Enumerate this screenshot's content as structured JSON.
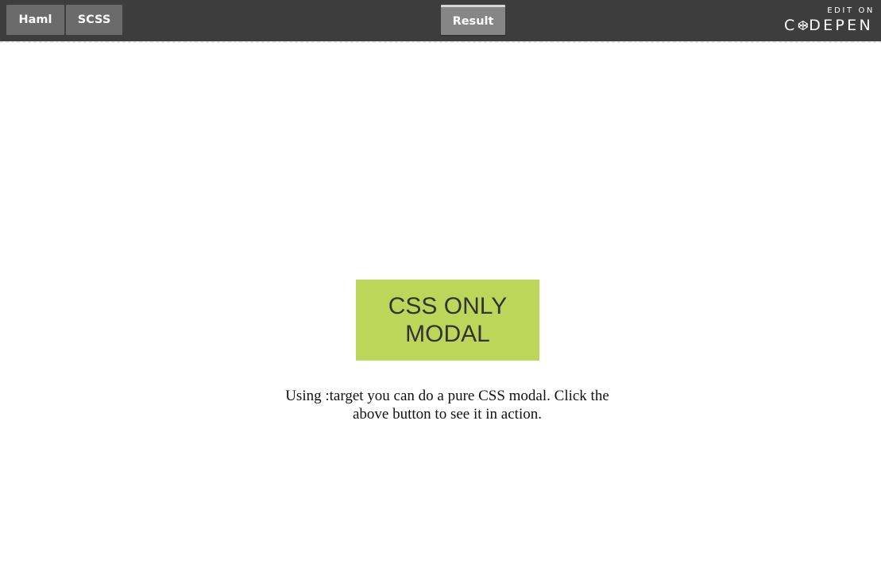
{
  "toolbar": {
    "tabs": [
      {
        "label": "Haml"
      },
      {
        "label": "SCSS"
      }
    ],
    "result_label": "Result",
    "edit_on": {
      "small_label": "EDIT ON",
      "brand_left": "C",
      "brand_right": "DEPEN"
    }
  },
  "main": {
    "button_label": "CSS ONLY\nMODAL",
    "description": "Using :target you can do a pure CSS modal. Click the above button to see it in action."
  },
  "colors": {
    "toolbar_bg": "#3d3d3e",
    "tab_bg": "#6b6b6b",
    "result_tab_bg": "#868686",
    "button_bg": "#bcd65a",
    "button_text": "#333333"
  },
  "icons": {
    "codepen_logo": "codepen-cube-icon"
  }
}
